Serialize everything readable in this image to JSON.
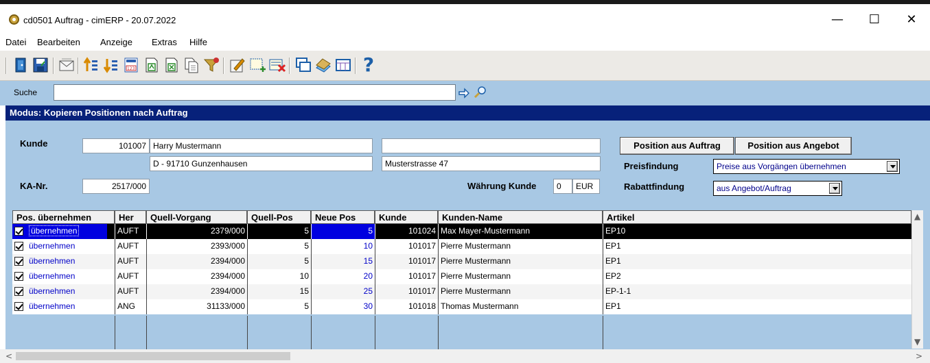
{
  "window": {
    "title": "cd0501 Auftrag - cimERP - 20.07.2022",
    "minimize": "—",
    "maximize": "☐",
    "close": "✕"
  },
  "menu": [
    "Datei",
    "Bearbeiten",
    "Anzeige",
    "Extras",
    "Hilfe"
  ],
  "toolbar": {
    "icons": [
      "exit-icon",
      "save-icon",
      "mail-icon",
      "sort-ascending-icon",
      "sort-descending-icon",
      "calculator-icon",
      "export-icon",
      "excel-export-icon",
      "copy-document-icon",
      "filter-icon",
      "edit-icon",
      "new-entry-icon",
      "delete-icon",
      "window-icon",
      "book-icon",
      "table-icon",
      "help-icon"
    ],
    "help_label": "?"
  },
  "search": {
    "label": "Suche",
    "value": ""
  },
  "mode": {
    "label": "Modus: Kopieren Positionen nach Auftrag"
  },
  "customer": {
    "label": "Kunde",
    "number": "101007",
    "name": "Harry Mustermann",
    "city": "D - 91710 Gunzenhausen",
    "name2": "",
    "street": "Musterstrasse 47",
    "ka_label": "KA-Nr.",
    "ka_number": "2517/000",
    "currency_label": "Währung Kunde",
    "currency_code": "0",
    "currency": "EUR"
  },
  "buttons": {
    "from_order": "Position aus Auftrag",
    "from_offer": "Position aus Angebot"
  },
  "pricing": {
    "label": "Preisfindung",
    "value": "Preise aus Vorgängen übernehmen"
  },
  "discount": {
    "label": "Rabattfindung",
    "value": "aus Angebot/Auftrag"
  },
  "table": {
    "columns": [
      "Pos. übernehmen",
      "Her",
      "Quell-Vorgang",
      "Quell-Pos",
      "Neue Pos",
      "Kunde",
      "Kunden-Name",
      "Artikel"
    ],
    "rows": [
      {
        "action": "übernehmen",
        "her": "AUFT",
        "source": "2379/000",
        "source_pos": "5",
        "new_pos": "5",
        "customer": "101024",
        "customer_name": "Max Mayer-Mustermann",
        "article": "EP10"
      },
      {
        "action": "übernehmen",
        "her": "AUFT",
        "source": "2393/000",
        "source_pos": "5",
        "new_pos": "10",
        "customer": "101017",
        "customer_name": "Pierre Mustermann",
        "article": "EP1"
      },
      {
        "action": "übernehmen",
        "her": "AUFT",
        "source": "2394/000",
        "source_pos": "5",
        "new_pos": "15",
        "customer": "101017",
        "customer_name": "Pierre Mustermann",
        "article": "EP1"
      },
      {
        "action": "übernehmen",
        "her": "AUFT",
        "source": "2394/000",
        "source_pos": "10",
        "new_pos": "20",
        "customer": "101017",
        "customer_name": "Pierre Mustermann",
        "article": "EP2"
      },
      {
        "action": "übernehmen",
        "her": "AUFT",
        "source": "2394/000",
        "source_pos": "15",
        "new_pos": "25",
        "customer": "101017",
        "customer_name": "Pierre Mustermann",
        "article": "EP-1-1"
      },
      {
        "action": "übernehmen",
        "her": "ANG",
        "source": "31133/000",
        "source_pos": "5",
        "new_pos": "30",
        "customer": "101018",
        "customer_name": "Thomas Mustermann",
        "article": "EP1"
      }
    ],
    "selected_row": 0
  },
  "scroll": {
    "left": "<",
    "right": ">",
    "up": "▲",
    "down": "▼"
  },
  "colors": {
    "panel": "#a8c8e4",
    "mode_bar": "#07217a",
    "selected_row": "#000000",
    "link_blue": "#0000c8"
  }
}
